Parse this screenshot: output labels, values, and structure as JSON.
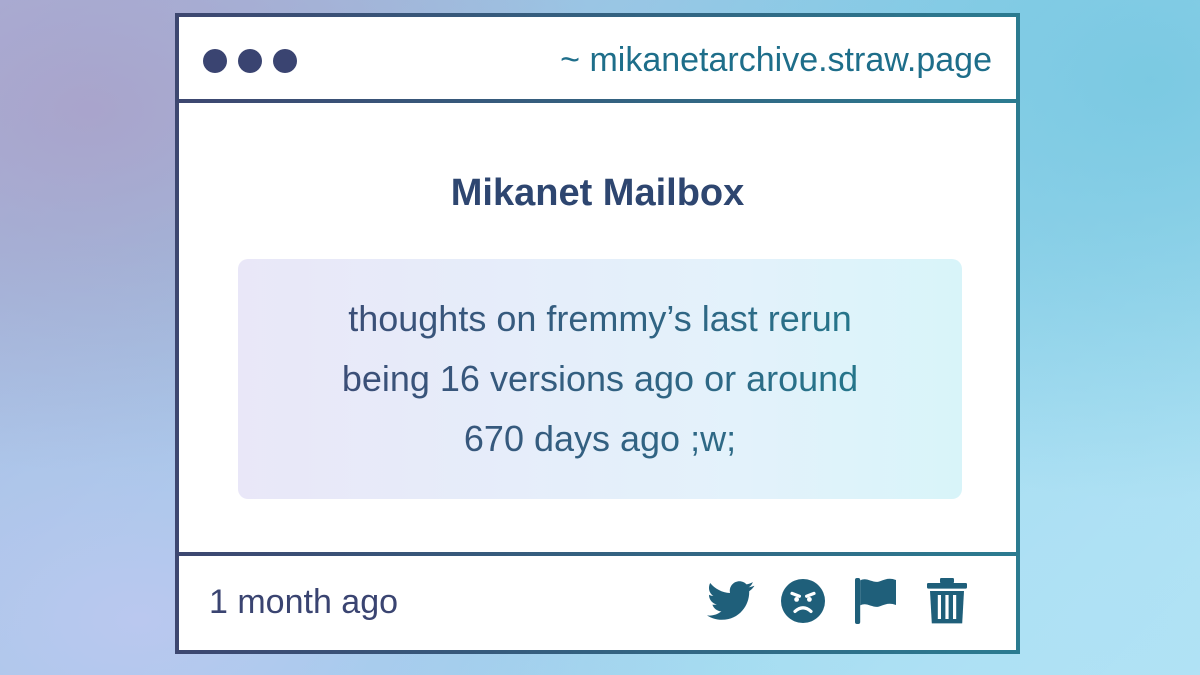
{
  "window": {
    "url": "~ mikanetarchive.straw.page"
  },
  "post": {
    "title": "Mikanet Mailbox",
    "message_lines": [
      "thoughts on fremmy’s last rerun",
      "being 16 versions ago or around",
      "670 days ago ;w;"
    ],
    "timestamp": "1 month ago"
  },
  "actions": [
    {
      "icon": "twitter-icon"
    },
    {
      "icon": "angry-face-icon"
    },
    {
      "icon": "flag-icon"
    },
    {
      "icon": "trash-icon"
    }
  ],
  "colors": {
    "border_start": "#3d4770",
    "border_end": "#2b7b90",
    "title": "#2e4670",
    "icon": "#1f5f7a",
    "dots": "#3a4471"
  }
}
